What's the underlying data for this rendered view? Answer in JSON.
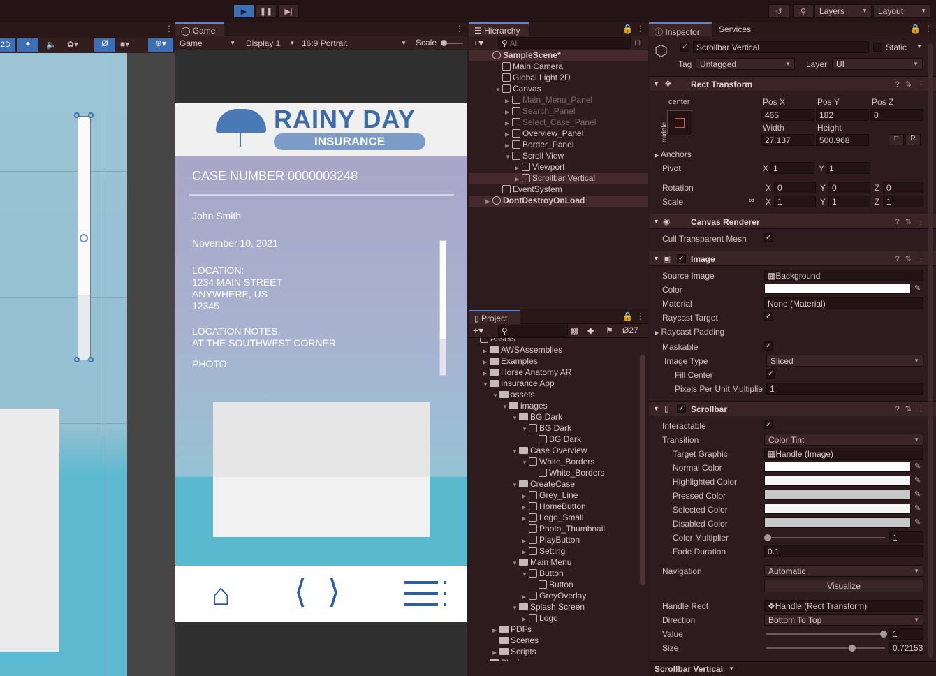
{
  "toolbar": {
    "layers_label": "Layers",
    "layout_label": "Layout"
  },
  "scene": {
    "mode_2d": "2D"
  },
  "game": {
    "tab": "Game",
    "view_dropdown": "Game",
    "display": "Display 1",
    "aspect": "16:9 Portrait",
    "scale_label": "Scale",
    "logo_line1": "RAINY DAY",
    "logo_line2": "INSURANCE",
    "case_number": "CASE NUMBER 0000003248",
    "name": "John Smith",
    "date": "November 10, 2021",
    "location_title": "LOCATION:",
    "location_l1": "1234 MAIN STREET",
    "location_l2": "ANYWHERE, US",
    "location_l3": "12345",
    "notes_title": "LOCATION NOTES:",
    "notes_text": "AT THE SOUTHWEST CORNER",
    "photo": "PHOTO:"
  },
  "hierarchy": {
    "tab": "Hierarchy",
    "search_placeholder": "All",
    "items": [
      {
        "label": "SampleScene*",
        "indent": 0,
        "open": true,
        "scene": true,
        "sel": true
      },
      {
        "label": "Main Camera",
        "indent": 1
      },
      {
        "label": "Global Light 2D",
        "indent": 1
      },
      {
        "label": "Canvas",
        "indent": 1,
        "open": true,
        "arrow": true
      },
      {
        "label": "Main_Menu_Panel",
        "indent": 2,
        "arrow": true,
        "dim": true
      },
      {
        "label": "Search_Panel",
        "indent": 2,
        "arrow": true,
        "dim": true
      },
      {
        "label": "Select_Case_Panel",
        "indent": 2,
        "arrow": true,
        "dim": true
      },
      {
        "label": "Overview_Panel",
        "indent": 2,
        "arrow": true
      },
      {
        "label": "Border_Panel",
        "indent": 2,
        "arrow": true
      },
      {
        "label": "Scroll View",
        "indent": 2,
        "arrow": true,
        "open": true
      },
      {
        "label": "Viewport",
        "indent": 3,
        "arrow": true
      },
      {
        "label": "Scrollbar Vertical",
        "indent": 3,
        "arrow": true,
        "sel": true
      },
      {
        "label": "EventSystem",
        "indent": 1
      },
      {
        "label": "DontDestroyOnLoad",
        "indent": 0,
        "arrow": true,
        "scene": true,
        "sel": true
      }
    ]
  },
  "project": {
    "tab": "Project",
    "hidden_count": "27",
    "items": [
      {
        "label": "Assets",
        "indent": 0
      },
      {
        "label": "AWSAssemblies",
        "indent": 1,
        "folder": true,
        "arrow": true
      },
      {
        "label": "Examples",
        "indent": 1,
        "folder": true,
        "arrow": true
      },
      {
        "label": "Horse Anatomy AR",
        "indent": 1,
        "folder": true,
        "arrow": true
      },
      {
        "label": "Insurance App",
        "indent": 1,
        "folder": true,
        "arrow": true,
        "open": true
      },
      {
        "label": "assets",
        "indent": 2,
        "folder": true,
        "arrow": true,
        "open": true
      },
      {
        "label": "images",
        "indent": 3,
        "folder": true,
        "arrow": true,
        "open": true
      },
      {
        "label": "BG Dark",
        "indent": 4,
        "folder": true,
        "arrow": true,
        "open": true
      },
      {
        "label": "BG Dark",
        "indent": 5,
        "arrow": true,
        "open": true
      },
      {
        "label": "BG Dark",
        "indent": 6
      },
      {
        "label": "Case Overview",
        "indent": 4,
        "folder": true,
        "arrow": true,
        "open": true
      },
      {
        "label": "White_Borders",
        "indent": 5,
        "arrow": true,
        "open": true
      },
      {
        "label": "White_Borders",
        "indent": 6
      },
      {
        "label": "CreateCase",
        "indent": 4,
        "folder": true,
        "arrow": true,
        "open": true
      },
      {
        "label": "Grey_Line",
        "indent": 5,
        "arrow": true
      },
      {
        "label": "HomeButton",
        "indent": 5,
        "arrow": true
      },
      {
        "label": "Logo_Small",
        "indent": 5,
        "arrow": true
      },
      {
        "label": "Photo_Thumbnail",
        "indent": 5
      },
      {
        "label": "PlayButton",
        "indent": 5,
        "arrow": true
      },
      {
        "label": "Setting",
        "indent": 5,
        "arrow": true
      },
      {
        "label": "Main Menu",
        "indent": 4,
        "folder": true,
        "arrow": true,
        "open": true
      },
      {
        "label": "Button",
        "indent": 5,
        "arrow": true,
        "open": true
      },
      {
        "label": "Button",
        "indent": 6
      },
      {
        "label": "GreyOverlay",
        "indent": 5,
        "arrow": true
      },
      {
        "label": "Splash Screen",
        "indent": 4,
        "folder": true,
        "arrow": true,
        "open": true
      },
      {
        "label": "Logo",
        "indent": 5,
        "arrow": true
      },
      {
        "label": "PDFs",
        "indent": 2,
        "folder": true,
        "arrow": true
      },
      {
        "label": "Scenes",
        "indent": 2,
        "folder": true
      },
      {
        "label": "Scripts",
        "indent": 2,
        "folder": true,
        "arrow": true
      },
      {
        "label": "Plugins",
        "indent": 1,
        "folder": true,
        "arrow": true
      }
    ]
  },
  "inspector": {
    "tab_inspector": "Inspector",
    "tab_services": "Services",
    "object_name": "Scrollbar Vertical",
    "static_label": "Static",
    "tag_label": "Tag",
    "tag_value": "Untagged",
    "layer_label": "Layer",
    "layer_value": "UI",
    "rect": {
      "title": "Rect Transform",
      "anchor_h": "center",
      "anchor_v": "middle",
      "posx_label": "Pos X",
      "posy_label": "Pos Y",
      "posz_label": "Pos Z",
      "posx": "465",
      "posy": "182",
      "posz": "0",
      "width_label": "Width",
      "height_label": "Height",
      "width": "27.137",
      "height": "500.968",
      "r_btn": "R",
      "anchors": "Anchors",
      "pivot": "Pivot",
      "pivot_x": "1",
      "pivot_y": "1",
      "rotation": "Rotation",
      "rot_x": "0",
      "rot_y": "0",
      "rot_z": "0",
      "scale": "Scale",
      "sc_x": "1",
      "sc_y": "1",
      "sc_z": "1",
      "x": "X",
      "y": "Y",
      "z": "Z"
    },
    "canvas_renderer": {
      "title": "Canvas Renderer",
      "cull": "Cull Transparent Mesh"
    },
    "image": {
      "title": "Image",
      "source_label": "Source Image",
      "source": "Background",
      "color": "Color",
      "material_label": "Material",
      "material": "None (Material)",
      "raycast_target": "Raycast Target",
      "raycast_padding": "Raycast Padding",
      "maskable": "Maskable",
      "image_type_label": "Image Type",
      "image_type": "Sliced",
      "fill_center": "Fill Center",
      "ppu_label": "Pixels Per Unit Multiplie",
      "ppu": "1"
    },
    "scrollbar": {
      "title": "Scrollbar",
      "interactable": "Interactable",
      "transition_label": "Transition",
      "transition": "Color Tint",
      "target_graphic_label": "Target Graphic",
      "target_graphic": "Handle (Image)",
      "normal": "Normal Color",
      "highlighted": "Highlighted Color",
      "pressed": "Pressed Color",
      "selected": "Selected Color",
      "disabled": "Disabled Color",
      "multiplier_label": "Color Multiplier",
      "multiplier": "1",
      "fade_label": "Fade Duration",
      "fade": "0.1",
      "navigation_label": "Navigation",
      "navigation": "Automatic",
      "visualize": "Visualize",
      "handle_rect_label": "Handle Rect",
      "handle_rect": "Handle (Rect Transform)",
      "direction_label": "Direction",
      "direction": "Bottom To Top",
      "value_label": "Value",
      "value": "1",
      "size_label": "Size",
      "size": "0.72153"
    },
    "footer": "Scrollbar Vertical"
  },
  "colors": {
    "accent": "#3d6fb6",
    "brand_blue": "#2d5fa0"
  }
}
